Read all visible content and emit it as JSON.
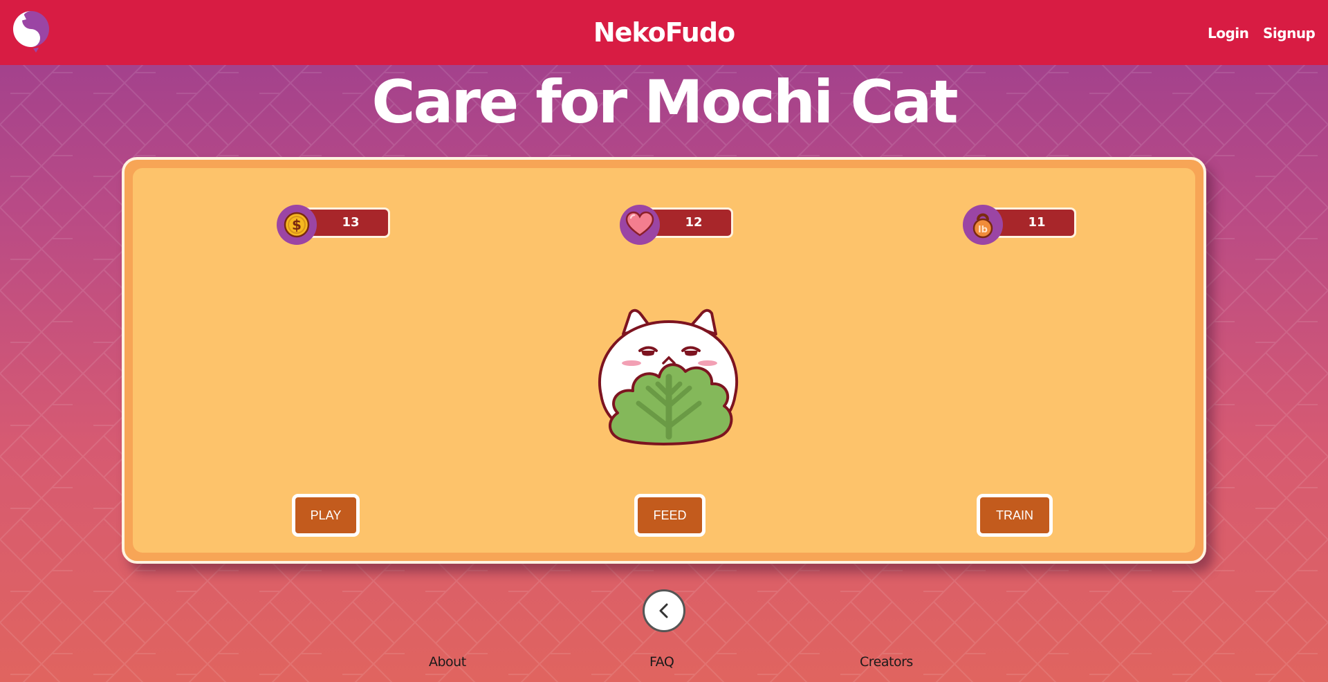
{
  "header": {
    "brand": "NekoFudo",
    "nav": {
      "login": "Login",
      "signup": "Signup"
    }
  },
  "page": {
    "title": "Care for Mochi Cat"
  },
  "stats": {
    "coins": {
      "icon": "dollar-coin-icon",
      "value": "13"
    },
    "hearts": {
      "icon": "heart-icon",
      "value": "12"
    },
    "weight": {
      "icon": "kettlebell-lb-icon",
      "value": "11"
    }
  },
  "pet": {
    "icon": "mochi-cat-holding-lettuce"
  },
  "actions": {
    "play": "PLAY",
    "feed": "FEED",
    "train": "TRAIN"
  },
  "back": {
    "icon": "chevron-left-icon"
  },
  "footer": {
    "about": "About",
    "faq": "FAQ",
    "creators": "Creators"
  },
  "colors": {
    "header": "#d81c43",
    "card": "#fdc36b",
    "card_border": "#f7a556",
    "stat_pill": "#a8262a",
    "stat_badge": "#9b45a4",
    "action_button": "#c35b1d"
  }
}
